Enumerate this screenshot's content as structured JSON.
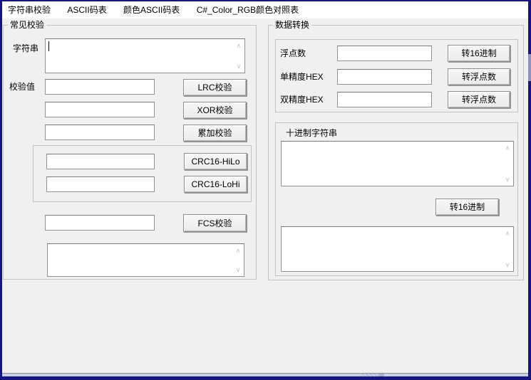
{
  "menu": {
    "items": [
      {
        "label": "字符串校验"
      },
      {
        "label": "ASCII码表"
      },
      {
        "label": "颜色ASCII码表"
      },
      {
        "label": "C#_Color_RGB颜色对照表"
      }
    ]
  },
  "left_group": {
    "title": "常见校验",
    "string_label": "字符串",
    "check_value_label": "校验值",
    "buttons": {
      "lrc": "LRC校验",
      "xor": "XOR校验",
      "sum": "累加校验",
      "crc_hilo": "CRC16-HiLo",
      "crc_lohi": "CRC16-LoHi",
      "fcs": "FCS校验"
    },
    "inputs": {
      "string_text": "",
      "checksum1": "",
      "checksum2": "",
      "checksum3": "",
      "crc1": "",
      "crc2": "",
      "fcs": "",
      "result_text": ""
    }
  },
  "right_group": {
    "title": "数据转换",
    "rows": [
      {
        "label": "浮点数",
        "button": "转16进制",
        "value": ""
      },
      {
        "label": "单精度HEX",
        "button": "转浮点数",
        "value": ""
      },
      {
        "label": "双精度HEX",
        "button": "转浮点数",
        "value": ""
      }
    ],
    "decimal_panel": {
      "title": "十进制字符串",
      "button": "转16进制",
      "decimal_text": "",
      "result_text": ""
    }
  },
  "icons": {
    "scroll_up": "∧",
    "scroll_down": "∨"
  },
  "colors": {
    "window_border": "#15157d",
    "bottom_strip": "#cbcfe6",
    "form_background": "#f0f0f0",
    "menu_background": "#ffffff"
  }
}
